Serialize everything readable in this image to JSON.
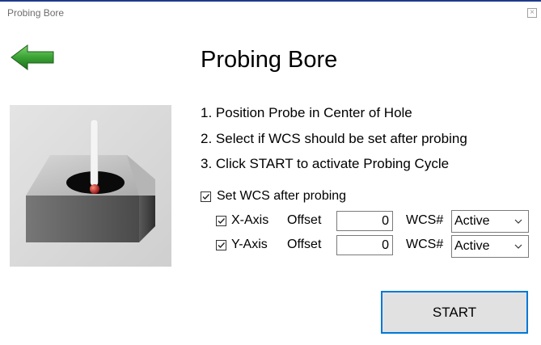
{
  "window": {
    "title": "Probing Bore",
    "close_glyph": "×"
  },
  "icons": {
    "back": "green-left-arrow-icon",
    "close": "close-icon"
  },
  "colors": {
    "title_accent": "#1f3a8a",
    "arrow_green": "#3aa335",
    "button_border": "#0078d7",
    "button_bg": "#e1e1e1"
  },
  "main": {
    "heading": "Probing Bore",
    "steps": [
      "1. Position Probe in Center of Hole",
      "2. Select if WCS should be set after probing",
      "3. Click START to activate Probing Cycle"
    ]
  },
  "options": {
    "set_wcs_label": "Set WCS after probing",
    "set_wcs_checked": true,
    "axes": [
      {
        "label": "X-Axis",
        "checked": true,
        "offset_label": "Offset",
        "offset_value": "0",
        "wcs_label": "WCS#",
        "wcs_value": "Active"
      },
      {
        "label": "Y-Axis",
        "checked": true,
        "offset_label": "Offset",
        "offset_value": "0",
        "wcs_label": "WCS#",
        "wcs_value": "Active"
      }
    ]
  },
  "actions": {
    "start_label": "START"
  }
}
